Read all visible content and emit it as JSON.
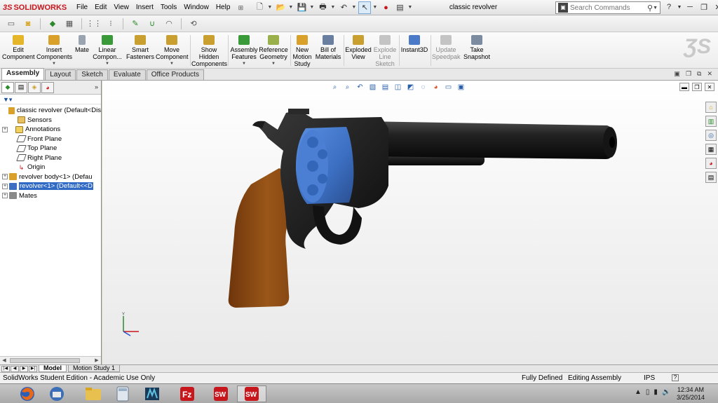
{
  "app": {
    "logo_prefix": "3S",
    "logo_name": "SOLIDWORKS",
    "document_title": "classic revolver",
    "menu": [
      "File",
      "Edit",
      "View",
      "Insert",
      "Tools",
      "Window",
      "Help"
    ],
    "search_placeholder": "Search Commands"
  },
  "commands": [
    {
      "label1": "Edit",
      "label2": "Component",
      "label3": "",
      "disabled": false
    },
    {
      "label1": "Insert",
      "label2": "Components",
      "label3": "",
      "disabled": false
    },
    {
      "label1": "Mate",
      "label2": "",
      "label3": "",
      "disabled": false
    },
    {
      "label1": "Linear",
      "label2": "Compon...",
      "label3": "",
      "disabled": false
    },
    {
      "label1": "Smart",
      "label2": "Fasteners",
      "label3": "",
      "disabled": false
    },
    {
      "label1": "Move",
      "label2": "Component",
      "label3": "",
      "disabled": false
    },
    {
      "label1": "Show",
      "label2": "Hidden",
      "label3": "Components",
      "disabled": false
    },
    {
      "label1": "Assembly",
      "label2": "Features",
      "label3": "",
      "disabled": false
    },
    {
      "label1": "Reference",
      "label2": "Geometry",
      "label3": "",
      "disabled": false
    },
    {
      "label1": "New",
      "label2": "Motion",
      "label3": "Study",
      "disabled": false
    },
    {
      "label1": "Bill of",
      "label2": "Materials",
      "label3": "",
      "disabled": false
    },
    {
      "label1": "Exploded",
      "label2": "View",
      "label3": "",
      "disabled": false
    },
    {
      "label1": "Explode",
      "label2": "Line",
      "label3": "Sketch",
      "disabled": true
    },
    {
      "label1": "Instant3D",
      "label2": "",
      "label3": "",
      "disabled": false
    },
    {
      "label1": "Update",
      "label2": "Speedpak",
      "label3": "",
      "disabled": true
    },
    {
      "label1": "Take",
      "label2": "Snapshot",
      "label3": "",
      "disabled": false
    }
  ],
  "tabs": [
    "Assembly",
    "Layout",
    "Sketch",
    "Evaluate",
    "Office Products"
  ],
  "tree": {
    "root": "classic revolver  (Default<Dis",
    "items": [
      {
        "label": "Sensors",
        "expandable": false,
        "selected": false
      },
      {
        "label": "Annotations",
        "expandable": true,
        "selected": false
      },
      {
        "label": "Front Plane",
        "expandable": false,
        "selected": false
      },
      {
        "label": "Top Plane",
        "expandable": false,
        "selected": false
      },
      {
        "label": "Right Plane",
        "expandable": false,
        "selected": false
      },
      {
        "label": "Origin",
        "expandable": false,
        "selected": false
      },
      {
        "label": "revolver body<1> (Defau",
        "expandable": true,
        "selected": false
      },
      {
        "label": "revolver<1> (Default<<D",
        "expandable": true,
        "selected": true
      },
      {
        "label": "Mates",
        "expandable": true,
        "selected": false
      }
    ]
  },
  "bottom_tabs": [
    "Model",
    "Motion Study 1"
  ],
  "status": {
    "edition": "SolidWorks Student Edition - Academic Use Only",
    "defined": "Fully Defined",
    "mode": "Editing Assembly",
    "units": "IPS",
    "help_mark": "?"
  },
  "clock": {
    "time": "12:34 AM",
    "date": "3/25/2014"
  },
  "colors": {
    "cylinder_blue": "#3c6fc2",
    "grip_brown": "#8b4a14",
    "frame_black": "#1b1b1b",
    "accent_red": "#c8161d",
    "selection_blue": "#316ac5"
  }
}
